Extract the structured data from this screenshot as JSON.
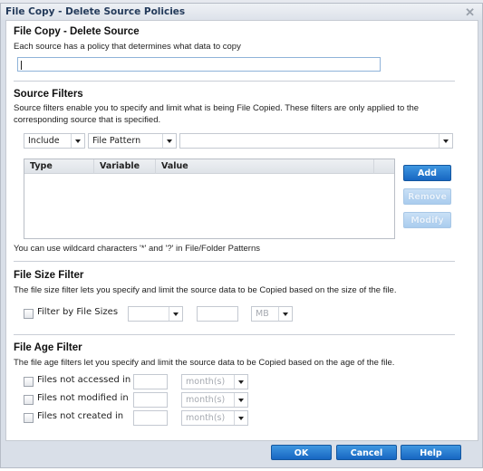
{
  "window": {
    "title": "File Copy - Delete Source Policies",
    "close_icon": "close-x-icon"
  },
  "policy": {
    "heading": "File Copy - Delete Source",
    "description": "Each source has a policy that determines what data to copy",
    "name_value": "",
    "name_placeholder": ""
  },
  "source_filters": {
    "heading": "Source Filters",
    "description_line1": "Source filters enable you to specify and limit what is being File Copied. These filters are only applied to the",
    "description_line2": "corresponding source that is specified.",
    "mode_select": {
      "value": "Include"
    },
    "kind_select": {
      "value": "File Pattern"
    },
    "value_select": {
      "value": ""
    },
    "table": {
      "columns": [
        "Type",
        "Variable",
        "Value"
      ],
      "rows": []
    },
    "buttons": {
      "add": "Add",
      "remove": "Remove",
      "modify": "Modify"
    },
    "wildcard_note": "You can use wildcard characters '*' and '?' in File/Folder Patterns"
  },
  "file_size_filter": {
    "heading": "File Size Filter",
    "description": "The file size filter lets you specify and limit the source data to be Copied based on the size of the file.",
    "checkbox_label": "Filter by File Sizes",
    "checked": false,
    "operator_select": {
      "value": ""
    },
    "size_value": "",
    "unit_select": {
      "value": "MB"
    }
  },
  "file_age_filter": {
    "heading": "File Age Filter",
    "description": "The file age filters let you specify and limit the source data to be Copied based on the age of the file.",
    "rows": [
      {
        "label": "Files not accessed in",
        "checked": false,
        "value": "",
        "unit": "month(s)"
      },
      {
        "label": "Files not modified in",
        "checked": false,
        "value": "",
        "unit": "month(s)"
      },
      {
        "label": "Files not created in",
        "checked": false,
        "value": "",
        "unit": "month(s)"
      }
    ]
  },
  "footer": {
    "ok": "OK",
    "cancel": "Cancel",
    "help": "Help"
  },
  "colors": {
    "primary_button": "#1766c2",
    "disabled_button": "#a9ccee",
    "dialog_bg": "#d9dfe8",
    "title_text": "#233a5a"
  }
}
